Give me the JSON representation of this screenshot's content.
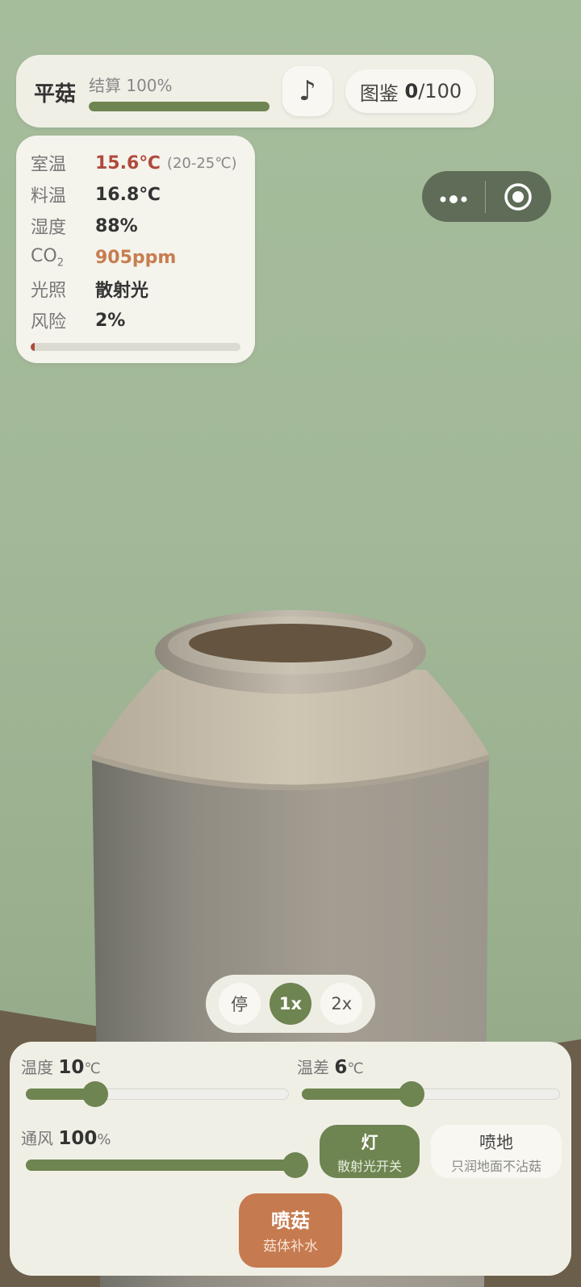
{
  "colors": {
    "accent_green": "#6e8451",
    "spray_orange": "#c67a4f",
    "warn_red": "#b04a3c",
    "warn_orange": "#c67d4f"
  },
  "header": {
    "species": "平菇",
    "settle_label": "结算 100%",
    "settle_progress": 1.0,
    "music_icon": "♪",
    "gallery_label": "图鉴",
    "gallery_count": "0",
    "gallery_total": "/100"
  },
  "stats": {
    "room_temp": {
      "label": "室温",
      "value": "15.6℃",
      "range": "(20-25℃)"
    },
    "substrate_temp": {
      "label": "料温",
      "value": "16.8℃"
    },
    "humidity": {
      "label": "湿度",
      "value": "88%"
    },
    "co2": {
      "label": "CO",
      "sub": "2",
      "value": "905ppm"
    },
    "light": {
      "label": "光照",
      "value": "散射光"
    },
    "risk": {
      "label": "风险",
      "value": "2%",
      "level": 0.02
    }
  },
  "speed": {
    "pause": "停",
    "x1": "1x",
    "x2": "2x",
    "selected": "1x"
  },
  "controls": {
    "temperature": {
      "label": "温度",
      "value": "10",
      "unit": "℃",
      "level": 0.25
    },
    "temp_diff": {
      "label": "温差",
      "value": "6",
      "unit": "℃",
      "level": 0.42
    },
    "ventilation": {
      "label": "通风",
      "value": "100",
      "unit": "%",
      "level": 1.0
    },
    "light_button": {
      "title": "灯",
      "subtitle": "散射光开关"
    },
    "spray_floor_button": {
      "title": "喷地",
      "subtitle": "只润地面不沾菇"
    },
    "spray_mushroom_button": {
      "title": "喷菇",
      "subtitle": "菇体补水"
    }
  }
}
